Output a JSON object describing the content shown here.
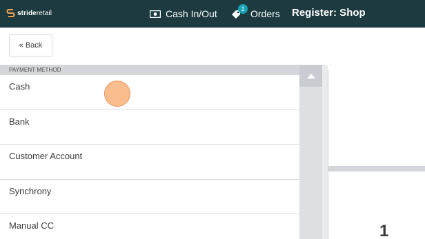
{
  "header": {
    "logo_text_bold": "stride",
    "logo_text_rest": "retail",
    "cash_label": "Cash In/Out",
    "orders_label": "Orders",
    "orders_badge": "1",
    "register_label": "Register: Shop"
  },
  "back_label": "« Back",
  "payment": {
    "section_label": "PAYMENT METHOD",
    "items": [
      {
        "label": "Cash"
      },
      {
        "label": "Bank"
      },
      {
        "label": "Customer Account"
      },
      {
        "label": "Synchrony"
      },
      {
        "label": "Manual CC"
      }
    ]
  },
  "keypad": {
    "visible_digit": "1"
  },
  "colors": {
    "header_bg": "#1d3a40",
    "badge": "#17a2b8",
    "section_bg": "#d3d6db"
  },
  "icons": [
    "stride-logo-icon",
    "cash-icon",
    "tag-icon",
    "chevron-up-icon"
  ]
}
